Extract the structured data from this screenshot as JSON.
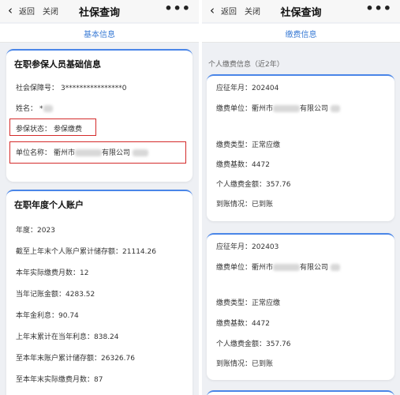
{
  "left": {
    "nav": {
      "back_label": "返回",
      "close_label": "关闭",
      "title": "社保查询"
    },
    "tab": {
      "label": "基本信息"
    },
    "basic_card": {
      "title": "在职参保人员基础信息",
      "ssn_label": "社会保障号：",
      "ssn_value": "3****************0",
      "name_label": "姓名：",
      "name_value": "*",
      "status_label": "参保状态：",
      "status_value": "参保缴费",
      "unit_label": "单位名称：",
      "unit_prefix": "衢州市",
      "unit_suffix": "有限公司"
    },
    "account_card": {
      "title": "在职年度个人账户",
      "rows": [
        {
          "label": "年度：",
          "value": "2023"
        },
        {
          "label": "截至上年末个人账户累计储存额：",
          "value": "21114.26"
        },
        {
          "label": "本年实际缴费月数：",
          "value": "12"
        },
        {
          "label": "当年记账金额：",
          "value": "4283.52"
        },
        {
          "label": "本年金利息：",
          "value": "90.74"
        },
        {
          "label": "上年末累计在当年利息：",
          "value": "838.24"
        },
        {
          "label": "至本年末账户累计储存额：",
          "value": "26326.76"
        },
        {
          "label": "至本年末实际缴费月数：",
          "value": "87"
        }
      ]
    }
  },
  "right": {
    "nav": {
      "back_label": "返回",
      "close_label": "关闭",
      "title": "社保查询"
    },
    "tab": {
      "label": "缴费信息"
    },
    "section_label": "个人缴费信息（近2年）",
    "records": [
      {
        "month_label": "应征年月：",
        "month_value": "202404",
        "unit_label": "缴费单位：",
        "unit_prefix": "衢州市",
        "unit_suffix": "有限公司",
        "type_label": "缴费类型：",
        "type_value": "正常应缴",
        "base_label": "缴费基数：",
        "base_value": "4472",
        "amount_label": "个人缴费金额：",
        "amount_value": "357.76",
        "arrival_label": "到账情况：",
        "arrival_value": "已到账"
      },
      {
        "month_label": "应征年月：",
        "month_value": "202403",
        "unit_label": "缴费单位：",
        "unit_prefix": "衢州市",
        "unit_suffix": "有限公司",
        "type_label": "缴费类型：",
        "type_value": "正常应缴",
        "base_label": "缴费基数：",
        "base_value": "4472",
        "amount_label": "个人缴费金额：",
        "amount_value": "357.76",
        "arrival_label": "到账情况：",
        "arrival_value": "已到账"
      }
    ]
  },
  "colors": {
    "accent": "#3a7bd5",
    "card_border": "#4a86e8",
    "highlight": "#d42b2b",
    "background": "#eef0f4"
  }
}
